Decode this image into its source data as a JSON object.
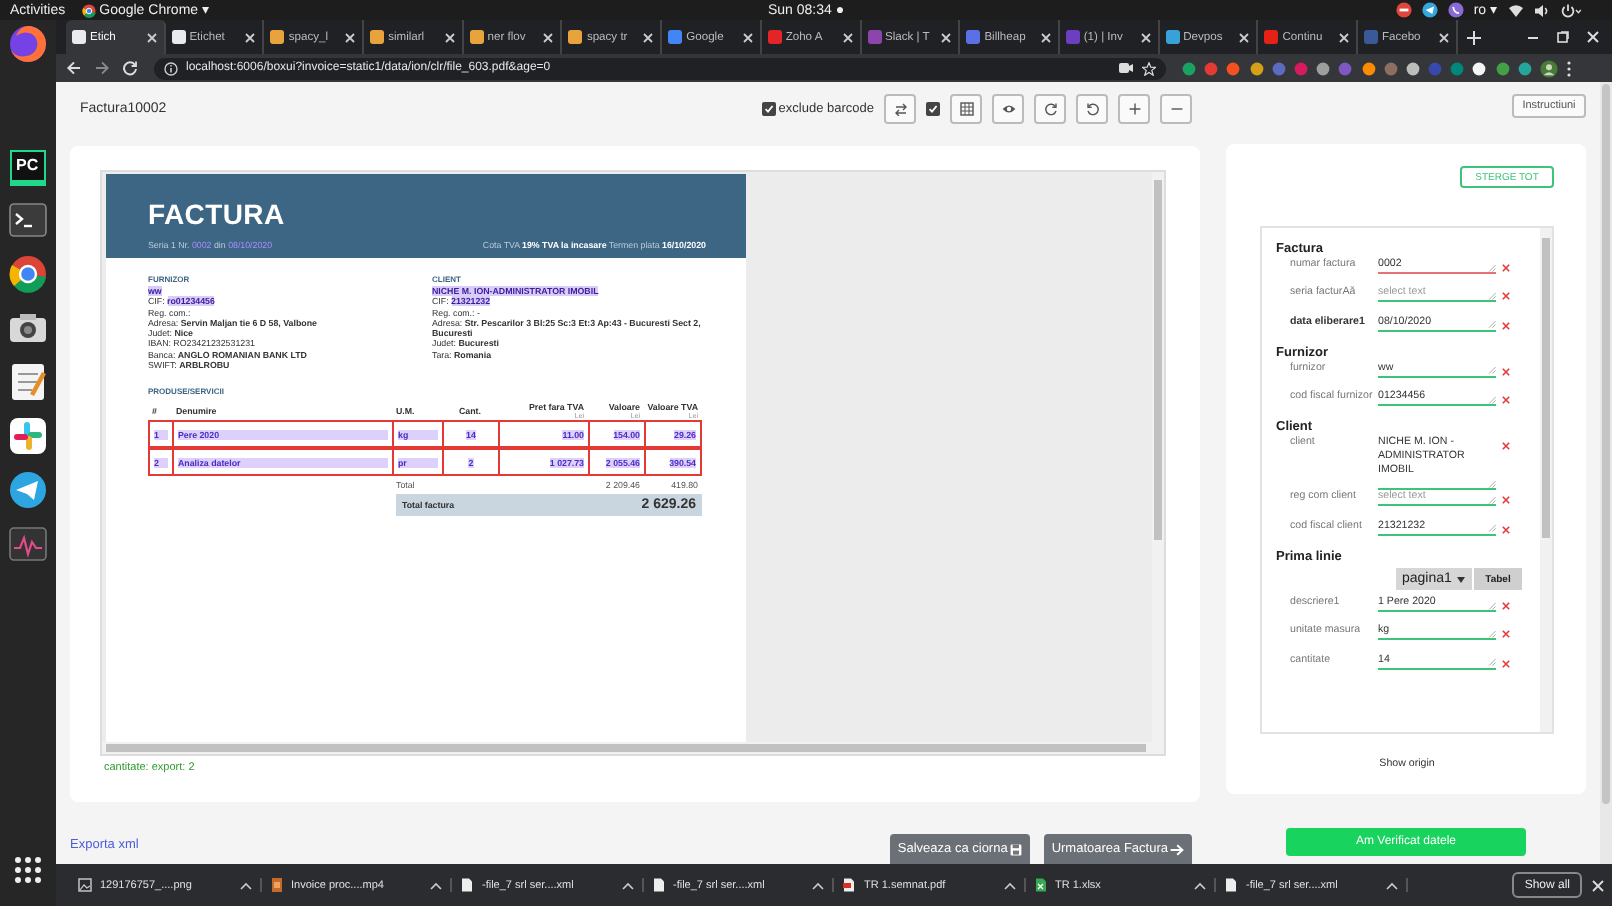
{
  "system_bar": {
    "activities": "Activities",
    "app_menu": "Google Chrome ▾",
    "clock": "Sun 08:34 ●",
    "keyboard_layout": "ro ▾"
  },
  "dock": [
    {
      "kind": "firefox"
    },
    {
      "kind": "pycharm",
      "label": "PC"
    },
    {
      "kind": "terminal"
    },
    {
      "kind": "chrome"
    },
    {
      "kind": "camera"
    },
    {
      "kind": "editor"
    },
    {
      "kind": "slack"
    },
    {
      "kind": "telegram"
    },
    {
      "kind": "monitor"
    },
    {
      "kind": "apps"
    }
  ],
  "browser": {
    "tabs": [
      {
        "title": "Etich",
        "color": "#e8eaed",
        "selected": true
      },
      {
        "title": "Etichet",
        "color": "#e8eaed",
        "selected": false
      },
      {
        "title": "spacy_l",
        "color": "#e8a33d",
        "selected": false
      },
      {
        "title": "similarl",
        "color": "#e8a33d",
        "selected": false
      },
      {
        "title": "ner flov",
        "color": "#e8a33d",
        "selected": false
      },
      {
        "title": "spacy tr",
        "color": "#e8a33d",
        "selected": false
      },
      {
        "title": "Google",
        "color": "#4285f4",
        "selected": false
      },
      {
        "title": "Zoho A",
        "color": "#e42527",
        "selected": false
      },
      {
        "title": "Slack | T",
        "color": "#8e44ad",
        "selected": false
      },
      {
        "title": "Billheap",
        "color": "#5b6fe6",
        "selected": false
      },
      {
        "title": "(1) | Inv",
        "color": "#6c3fc1",
        "selected": false
      },
      {
        "title": "Devpos",
        "color": "#3aa0d8",
        "selected": false
      },
      {
        "title": "Continu",
        "color": "#e62117",
        "selected": false
      },
      {
        "title": "Facebo",
        "color": "#3b5998",
        "selected": false
      }
    ],
    "address": "localhost:6006/boxui?invoice=static1/data/ion/clr/file_603.pdf&age=0"
  },
  "page": {
    "title": "Factura10002",
    "toolbar": {
      "exclude_barcode": {
        "label": "exclude barcode",
        "checked": true
      },
      "table_checkbox": {
        "checked": true
      },
      "buttons": [
        {
          "kind": "swap"
        },
        {
          "kind": "grid"
        },
        {
          "kind": "eye"
        },
        {
          "kind": "rotate_right"
        },
        {
          "kind": "rotate_left"
        },
        {
          "kind": "zoom_in"
        },
        {
          "kind": "zoom_out"
        }
      ]
    },
    "instructions_button": "Instructiuni",
    "document": {
      "title": "FACTURA",
      "series_line": [
        {
          "text": "Seria 1 Nr. ",
          "kind": "text"
        },
        {
          "text": "0002",
          "kind": "selection"
        },
        {
          "text": " din ",
          "kind": "text"
        },
        {
          "text": "08/10/2020",
          "kind": "selection"
        }
      ],
      "terms_line": "Cota TVA **19%**  **TVA la incasare**  Termen plata **16/10/2020**",
      "supplier": {
        "heading": "FURNIZOR",
        "lines": [
          [
            {
              "text": "ww",
              "kind": "selection"
            }
          ],
          [
            {
              "text": "CIF: ",
              "kind": "text"
            },
            {
              "text": "ro01234456",
              "kind": "selection"
            }
          ],
          [
            {
              "text": "Reg. com.:",
              "kind": "text"
            }
          ],
          [
            {
              "text": "Adresa: ",
              "kind": "text"
            },
            {
              "text": "Servin Maljan tie 6 D 58, Valbone",
              "kind": "value"
            }
          ],
          [
            {
              "text": "Judet: ",
              "kind": "text"
            },
            {
              "text": "Nice",
              "kind": "value"
            }
          ],
          [
            {
              "text": "IBAN: RO23421232531231",
              "kind": "text"
            }
          ],
          [
            {
              "text": "Banca: ",
              "kind": "text"
            },
            {
              "text": "ANGLO ROMANIAN BANK LTD",
              "kind": "value"
            }
          ],
          [
            {
              "text": "SWIFT: ",
              "kind": "text"
            },
            {
              "text": "ARBLROBU",
              "kind": "value"
            }
          ]
        ]
      },
      "client": {
        "heading": "CLIENT",
        "lines": [
          [
            {
              "text": "NICHE M. ION-ADMINISTRATOR IMOBIL",
              "kind": "selection"
            }
          ],
          [
            {
              "text": "CIF: ",
              "kind": "text"
            },
            {
              "text": "21321232",
              "kind": "selection"
            }
          ],
          [
            {
              "text": "Reg. com.: -",
              "kind": "text"
            }
          ],
          [
            {
              "text": "Adresa: ",
              "kind": "text"
            },
            {
              "text": "Str. Pescarilor 3 Bl:25 Sc:3 Et:3 Ap:43 - Bucuresti Sect 2, Bucuresti",
              "kind": "value"
            }
          ],
          [
            {
              "text": "Judet: ",
              "kind": "text"
            },
            {
              "text": "Bucuresti",
              "kind": "value"
            }
          ],
          [
            {
              "text": "Tara: ",
              "kind": "text"
            },
            {
              "text": "Romania",
              "kind": "value"
            }
          ]
        ]
      },
      "items_heading": "PRODUSE/SERVICII",
      "columns": [
        {
          "label": "#"
        },
        {
          "label": "Denumire"
        },
        {
          "label": "U.M."
        },
        {
          "label": "Cant."
        },
        {
          "label": "Pret fara TVA",
          "unit": "Lei"
        },
        {
          "label": "Valoare",
          "unit": "Lei"
        },
        {
          "label": "Valoare TVA",
          "unit": "Lei"
        }
      ],
      "rows": [
        {
          "cells": [
            "1",
            "Pere 2020",
            "kg",
            "14",
            "11.00",
            "154.00",
            "29.26"
          ],
          "marked": true
        },
        {
          "cells": [
            "2",
            "Analiza datelor",
            "pr",
            "2",
            "1 027.73",
            "2 055.46",
            "390.54"
          ],
          "marked": true
        }
      ],
      "totals": {
        "label": "Total",
        "values": [
          "2 209.46",
          "419.80"
        ]
      },
      "grand_total": {
        "label": "Total factura",
        "value": "2 629.26"
      }
    },
    "footnote": "cantitate: export: 2",
    "form": {
      "clear_button": "STERGE TOT",
      "sections": [
        {
          "title": "Factura",
          "fields": [
            {
              "label": "numar factura",
              "value": "0002",
              "valid": false
            },
            {
              "label": "seria facturAă",
              "placeholder": "select text",
              "valid": true
            },
            {
              "label": "data eliberare1",
              "value": "08/10/2020",
              "valid": true,
              "emphasized": true
            }
          ]
        },
        {
          "title": "Furnizor",
          "fields": [
            {
              "label": "furnizor",
              "value": "ww",
              "valid": true
            },
            {
              "label": "cod fiscal furnizor",
              "value": "01234456",
              "valid": true
            }
          ]
        },
        {
          "title": "Client",
          "fields": [
            {
              "label": "client",
              "value": "NICHE M. ION - ADMINISTRATOR IMOBIL",
              "valid": true,
              "multiline": true
            },
            {
              "label": "reg com client",
              "placeholder": "select text",
              "valid": true
            },
            {
              "label": "cod fiscal client",
              "value": "21321232",
              "valid": true
            }
          ]
        },
        {
          "title": "Prima linie",
          "controls": {
            "page_select": "pagina1",
            "table_button": "Tabel"
          },
          "fields": [
            {
              "label": "descriere1",
              "value": "1 Pere 2020",
              "valid": true
            },
            {
              "label": "unitate masura",
              "value": "kg",
              "valid": true
            },
            {
              "label": "cantitate",
              "value": "14",
              "valid": true
            }
          ]
        }
      ]
    },
    "show_origin": "Show origin",
    "export_link": "Exporta xml",
    "save_draft_button": "Salveaza ca ciorna",
    "next_button": "Urmatoarea Factura",
    "verify_button": "Am Verificat datele"
  },
  "downloads": {
    "items": [
      {
        "name": "129176757_....png",
        "kind": "image"
      },
      {
        "name": "Invoice proc....mp4",
        "kind": "video"
      },
      {
        "name": "-file_7 srl ser....xml",
        "kind": "document"
      },
      {
        "name": "-file_7 srl ser....xml",
        "kind": "document"
      },
      {
        "name": "TR 1.semnat.pdf",
        "kind": "pdf"
      },
      {
        "name": "TR 1.xlsx",
        "kind": "sheet"
      },
      {
        "name": "-file_7 srl ser....xml",
        "kind": "document"
      }
    ],
    "show_all": "Show all"
  }
}
